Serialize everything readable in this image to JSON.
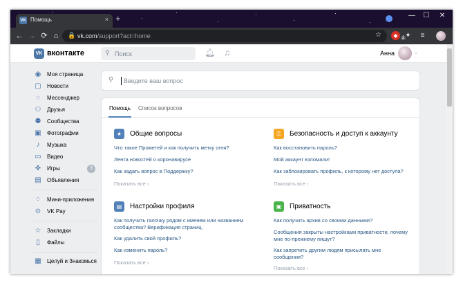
{
  "browser": {
    "tab_title": "Помощь",
    "tab_close": "×",
    "new_tab": "+",
    "url_host": "vk.com",
    "url_path": "/support?act=home",
    "extension_badge": "2",
    "window_controls": [
      "—",
      "☐",
      "✕"
    ],
    "nav": {
      "back": "←",
      "forward": "→",
      "reload": "⟳",
      "home": "⌂"
    }
  },
  "header": {
    "logo_text": "вконтакте",
    "logo_mark": "VK",
    "search_placeholder": "Поиск",
    "user_name": "Анна",
    "icons": [
      "bell-icon",
      "music-note-icon"
    ]
  },
  "sidebar": {
    "items": [
      {
        "label": "Моя страница",
        "icon": "user-icon"
      },
      {
        "label": "Новости",
        "icon": "news-icon"
      },
      {
        "label": "Мессенджер",
        "icon": "chat-icon"
      },
      {
        "label": "Друзья",
        "icon": "friends-icon"
      },
      {
        "label": "Сообщества",
        "icon": "groups-icon"
      },
      {
        "label": "Фотографии",
        "icon": "photo-icon"
      },
      {
        "label": "Музыка",
        "icon": "music-icon"
      },
      {
        "label": "Видео",
        "icon": "video-icon"
      },
      {
        "label": "Игры",
        "icon": "games-icon",
        "badge": "3"
      },
      {
        "label": "Объявления",
        "icon": "ads-icon"
      },
      {
        "label": "Мини-приложения",
        "icon": "apps-icon"
      },
      {
        "label": "VK Pay",
        "icon": "vkpay-icon"
      },
      {
        "label": "Закладки",
        "icon": "bookmark-icon"
      },
      {
        "label": "Файлы",
        "icon": "files-icon"
      },
      {
        "label": "Целуй и Знакомься",
        "icon": "app-icon"
      }
    ]
  },
  "support": {
    "question_placeholder": "Введите ваш вопрос",
    "tabs": [
      {
        "label": "Помощь",
        "active": true
      },
      {
        "label": "Список вопросов",
        "active": false
      }
    ],
    "show_all_label": "Показать все",
    "sections": [
      {
        "title": "Общие вопросы",
        "icon": "star-icon",
        "color": "#5181b8",
        "links": [
          "Что такое Прометей и как получить метку огня?",
          "Лента новостей о коронавирусе",
          "Как задать вопрос в Поддержку?"
        ]
      },
      {
        "title": "Безопасность и доступ к аккаунту",
        "icon": "key-icon",
        "color": "#f5a623",
        "links": [
          "Как восстановить пароль?",
          "Мой аккаунт взломали!",
          "Как заблокировать профиль, к которому нет доступа?"
        ]
      },
      {
        "title": "Настройки профиля",
        "icon": "profile-card-icon",
        "color": "#5181b8",
        "links": [
          "Как получить галочку рядом с именем или названием сообщества? Верификация страниц.",
          "Как удалить свой профиль?",
          "Как изменить пароль?"
        ]
      },
      {
        "title": "Приватность",
        "icon": "lock-icon",
        "color": "#4bb34b",
        "links": [
          "Как получить архив со своими данными?",
          "Сообщения закрыты настройками приватности, почему мне по-прежнему пишут?",
          "Как запретить другим людям присылать мне сообщения?"
        ]
      }
    ]
  },
  "colors": {
    "accent": "#4a76a8",
    "link": "#2a5885",
    "page_bg": "#edeef0"
  }
}
